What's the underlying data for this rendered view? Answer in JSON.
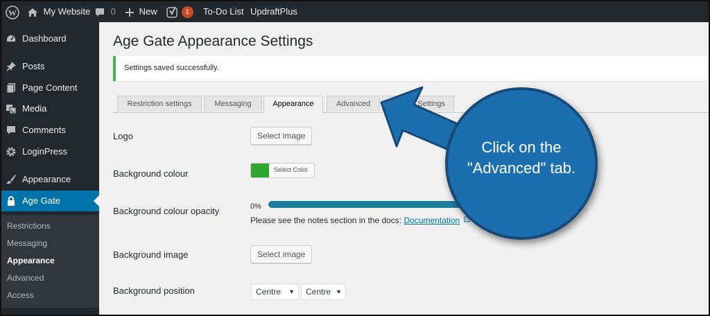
{
  "adminbar": {
    "site_name": "My Website",
    "comments_count": "0",
    "new_label": "New",
    "notifications_count": "1",
    "todo_label": "To-Do List",
    "updraft_label": "UpdraftPlus"
  },
  "sidebar": {
    "items": [
      {
        "label": "Dashboard",
        "icon": "dashboard-icon"
      },
      {
        "label": "Posts",
        "icon": "pin-icon"
      },
      {
        "label": "Page Content",
        "icon": "page-icon"
      },
      {
        "label": "Media",
        "icon": "media-icon"
      },
      {
        "label": "Comments",
        "icon": "comment-icon"
      },
      {
        "label": "LoginPress",
        "icon": "gear-icon"
      },
      {
        "label": "Appearance",
        "icon": "brush-icon"
      },
      {
        "label": "Age Gate",
        "icon": "lock-icon"
      }
    ],
    "submenu": [
      "Restrictions",
      "Messaging",
      "Appearance",
      "Advanced",
      "Access"
    ]
  },
  "page": {
    "title": "Age Gate Appearance Settings",
    "notice": "Settings saved successfully."
  },
  "tabs": [
    "Restriction settings",
    "Messaging",
    "Appearance",
    "Advanced",
    "Settings"
  ],
  "fields": {
    "logo_label": "Logo",
    "logo_button": "Select image",
    "bg_colour_label": "Background colour",
    "bg_colour_button": "Select Color",
    "bg_colour_value": "#30a630",
    "opacity_label": "Background colour opacity",
    "opacity_value": "0%",
    "note_text": "Please see the notes section in the docs: ",
    "note_link": "Documentation",
    "bg_image_label": "Background image",
    "bg_image_button": "Select image",
    "bg_position_label": "Background position",
    "bg_position_x": "Centre",
    "bg_position_y": "Centre"
  },
  "callout": {
    "text": "Click on the\n\"Advanced\" tab."
  },
  "colors": {
    "adminbar_bg": "#23282d",
    "accent": "#0073aa",
    "callout": "#1c6fae",
    "notice_border": "#46b450"
  }
}
